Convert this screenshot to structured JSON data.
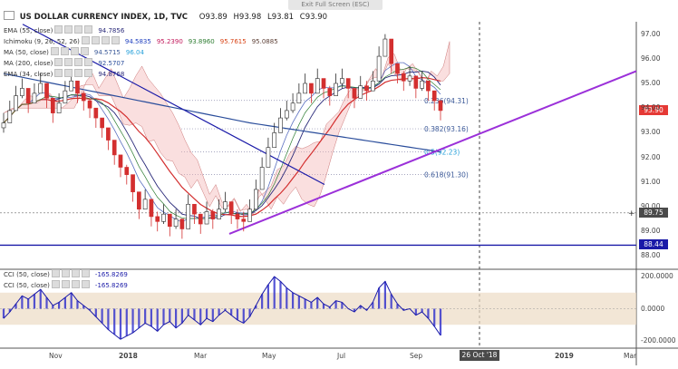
{
  "window": {
    "exit_label": "Exit Full Screen (ESC)"
  },
  "header": {
    "symbol": "US DOLLAR CURRENCY INDEX, 1D, TVC",
    "o_label": "O",
    "o": "93.89",
    "h_label": "H",
    "h": "93.98",
    "l_label": "L",
    "l": "93.81",
    "c_label": "C",
    "c": "93.90"
  },
  "indicators": [
    {
      "label": "EMA (55, close)",
      "values": [
        "94.7856"
      ],
      "colors": [
        "#2a2a7a"
      ]
    },
    {
      "label": "Ichimoku (9, 26, 52, 26)",
      "values": [
        "94.5835",
        "95.2390",
        "93.8960",
        "95.7615",
        "95.0885"
      ],
      "colors": [
        "#1e3fbf",
        "#c2185b",
        "#2e7d32",
        "#d84315",
        "#5d4037"
      ]
    },
    {
      "label": "MA (50, close)",
      "values": [
        "94.5715",
        "96.04"
      ],
      "colors": [
        "#3b5998",
        "#26a0da"
      ]
    },
    {
      "label": "MA (200, close)",
      "values": [
        "92.5707"
      ],
      "colors": [
        "#2a4d9b"
      ]
    },
    {
      "label": "EMA (34, close)",
      "values": [
        "94.8768"
      ],
      "colors": [
        "#2a2a7a"
      ]
    }
  ],
  "cci_indicators": [
    {
      "label": "CCI (50, close)",
      "value": "-165.8269"
    },
    {
      "label": "CCI (50, close)",
      "value": "-165.8269"
    }
  ],
  "price_tags": [
    {
      "value": "93.90",
      "price": 93.9,
      "color": "#e53935"
    },
    {
      "value": "89.75",
      "price": 89.75,
      "color": "#4a4a4a"
    },
    {
      "value": "88.44",
      "price": 88.44,
      "color": "#1a1aa8"
    }
  ],
  "time_tag": {
    "label": "26 Oct '18"
  },
  "chart_data": {
    "type": "candlestick",
    "price_axis": {
      "ticks": [
        "97.00",
        "96.00",
        "95.00",
        "94.00",
        "93.00",
        "92.00",
        "91.00",
        "90.00",
        "89.00",
        "88.00"
      ],
      "range": [
        87.5,
        97.5
      ]
    },
    "cci_axis": {
      "ticks": [
        "200.0000",
        "0.0000",
        "-200.0000"
      ],
      "range": [
        -240,
        240
      ]
    },
    "time_axis": {
      "ticks": [
        "Nov",
        "2018",
        "Mar",
        "May",
        "Jul",
        "Sep",
        "2019",
        "Mar"
      ]
    },
    "fibonacci": [
      {
        "label": "0.236(94.31)",
        "price": 94.31
      },
      {
        "label": "0.382(93.16)",
        "price": 93.16
      },
      {
        "label": "0.5(92.23)",
        "price": 92.23
      },
      {
        "label": "0.618(91.30)",
        "price": 91.3
      }
    ],
    "close_series": [
      93.4,
      93.9,
      94.5,
      94.8,
      94.2,
      94.6,
      95.0,
      94.4,
      93.8,
      94.2,
      94.7,
      95.1,
      94.6,
      94.3,
      94.0,
      93.6,
      93.2,
      92.7,
      92.1,
      91.6,
      91.3,
      90.6,
      89.9,
      90.3,
      89.6,
      89.4,
      89.7,
      89.2,
      89.5,
      89.1,
      90.1,
      89.7,
      89.3,
      89.8,
      89.5,
      89.9,
      90.2,
      89.7,
      89.5,
      89.4,
      89.9,
      90.7,
      91.6,
      92.4,
      93.0,
      93.6,
      93.9,
      94.2,
      94.6,
      95.0,
      94.6,
      95.2,
      94.8,
      94.5,
      95.0,
      95.2,
      94.8,
      94.4,
      94.9,
      94.7,
      95.1,
      96.1,
      96.8,
      95.8,
      95.4,
      95.1,
      95.3,
      94.8,
      95.1,
      94.7,
      94.3,
      93.9
    ],
    "high_series": [
      93.8,
      94.3,
      94.9,
      95.2,
      94.6,
      95.0,
      95.4,
      94.8,
      94.2,
      94.6,
      95.1,
      95.5,
      95.0,
      94.7,
      94.4,
      94.0,
      93.6,
      93.1,
      92.5,
      92.0,
      91.7,
      91.0,
      90.3,
      90.7,
      90.0,
      89.8,
      90.1,
      89.6,
      89.9,
      89.5,
      90.5,
      90.1,
      89.7,
      90.2,
      89.9,
      90.3,
      90.6,
      90.1,
      89.9,
      89.8,
      90.3,
      91.1,
      92.0,
      92.8,
      93.4,
      94.0,
      94.3,
      94.6,
      95.0,
      95.4,
      95.0,
      95.6,
      95.2,
      94.9,
      95.4,
      95.6,
      95.2,
      94.8,
      95.3,
      95.1,
      95.5,
      96.5,
      97.0,
      96.2,
      95.8,
      95.5,
      95.7,
      95.2,
      95.5,
      95.1,
      94.7,
      94.3
    ],
    "low_series": [
      93.0,
      93.5,
      94.1,
      94.4,
      93.8,
      94.2,
      94.6,
      94.0,
      93.4,
      93.8,
      94.3,
      94.7,
      94.2,
      93.9,
      93.6,
      93.2,
      92.8,
      92.3,
      91.7,
      91.2,
      90.9,
      90.2,
      89.5,
      89.9,
      89.2,
      89.0,
      89.3,
      88.8,
      89.1,
      88.7,
      89.7,
      89.3,
      88.9,
      89.4,
      89.1,
      89.5,
      89.8,
      89.3,
      89.1,
      89.0,
      89.5,
      90.3,
      91.2,
      92.0,
      92.6,
      93.2,
      93.5,
      93.8,
      94.2,
      94.6,
      94.2,
      94.8,
      94.4,
      94.1,
      94.6,
      94.8,
      94.4,
      94.0,
      94.5,
      94.3,
      94.7,
      95.7,
      96.4,
      95.4,
      95.0,
      94.7,
      94.9,
      94.4,
      94.7,
      94.3,
      93.9,
      93.5
    ],
    "cci_series": [
      -60,
      -20,
      30,
      80,
      60,
      90,
      120,
      70,
      20,
      40,
      70,
      100,
      50,
      20,
      -10,
      -50,
      -90,
      -130,
      -160,
      -190,
      -170,
      -150,
      -120,
      -90,
      -110,
      -140,
      -100,
      -80,
      -120,
      -90,
      -40,
      -70,
      -100,
      -60,
      -80,
      -40,
      -10,
      -40,
      -70,
      -90,
      -50,
      20,
      90,
      150,
      200,
      170,
      130,
      100,
      80,
      60,
      40,
      70,
      30,
      10,
      50,
      40,
      0,
      -20,
      20,
      -10,
      40,
      130,
      170,
      90,
      30,
      -10,
      0,
      -40,
      -20,
      -60,
      -110,
      -165.8269
    ]
  }
}
